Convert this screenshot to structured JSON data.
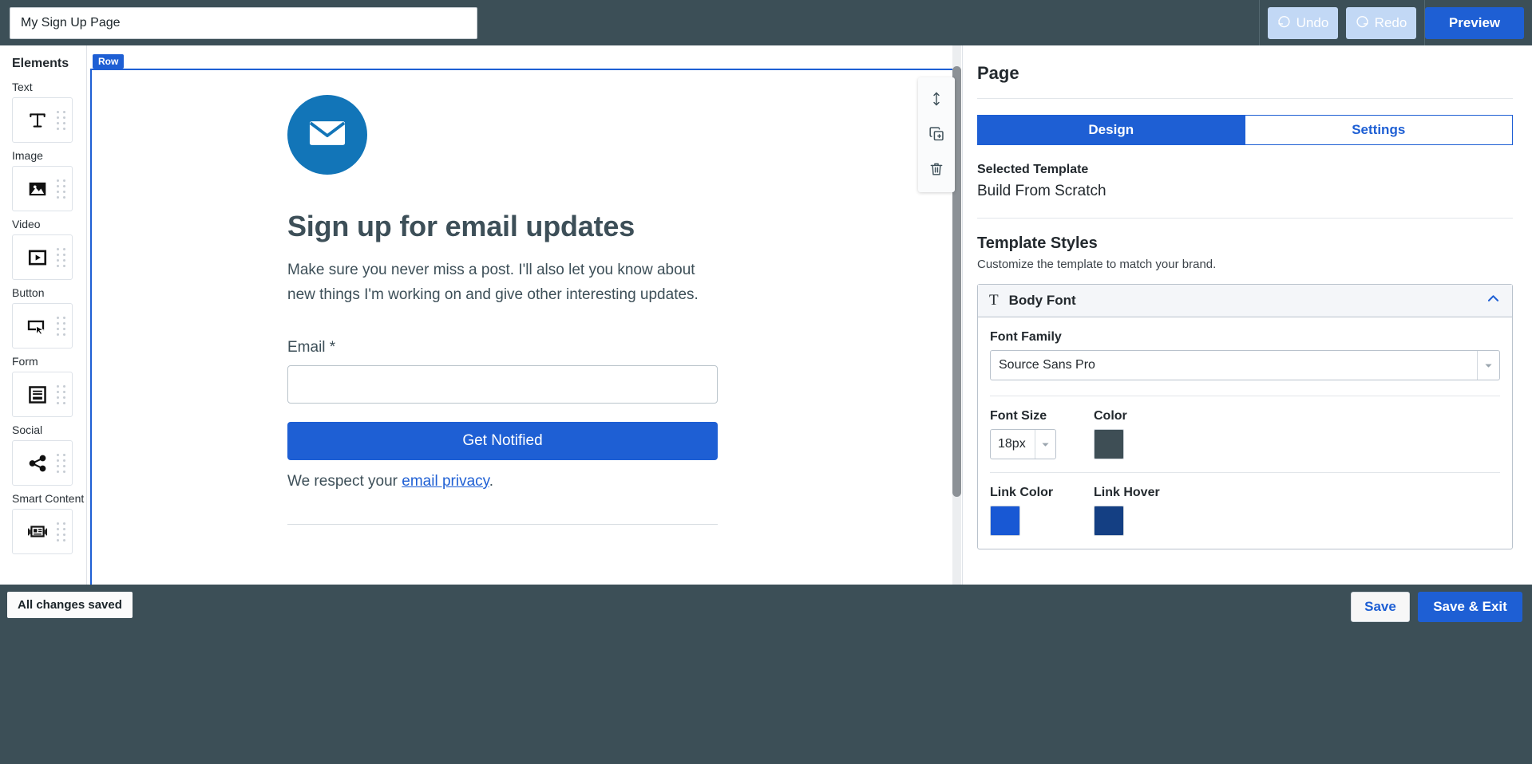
{
  "topbar": {
    "page_title_value": "My Sign Up Page",
    "page_title_placeholder": "Page name",
    "undo_label": "Undo",
    "redo_label": "Redo",
    "preview_label": "Preview",
    "undo_icon": "undo-arrow-icon",
    "redo_icon": "redo-arrow-icon",
    "bar_color": "#3c4f57",
    "primary_color": "#1e5fd4",
    "undo_redo_color": "#c2d8f5"
  },
  "sidebar": {
    "heading": "Elements",
    "items": [
      {
        "label": "Text",
        "icon": "text-t-icon"
      },
      {
        "label": "Image",
        "icon": "image-picture-icon"
      },
      {
        "label": "Video",
        "icon": "video-play-icon"
      },
      {
        "label": "Button",
        "icon": "button-cursor-icon"
      },
      {
        "label": "Form",
        "icon": "form-lines-icon"
      },
      {
        "label": "Social",
        "icon": "social-share-icon"
      },
      {
        "label": "Smart Content",
        "icon": "smart-content-icon"
      }
    ]
  },
  "canvas": {
    "row_badge": "Row",
    "tools": [
      {
        "name": "move-row",
        "icon": "move-vertical-icon"
      },
      {
        "name": "duplicate-row",
        "icon": "duplicate-icon"
      },
      {
        "name": "delete-row",
        "icon": "trash-icon"
      }
    ],
    "envelope_icon": "envelope-icon",
    "envelope_bg": "#1275b8",
    "heading": "Sign up for email updates",
    "paragraph": "Make sure you never miss a post. I'll also let you know about new things I'm working on and give other interesting updates.",
    "email_label": "Email *",
    "email_value": "",
    "email_placeholder": "",
    "submit_label": "Get Notified",
    "privacy_prefix": "We respect your ",
    "privacy_link": "email privacy",
    "privacy_suffix": ".",
    "text_color": "#3d4f58",
    "button_color": "#1e5fd4"
  },
  "right_panel": {
    "title": "Page",
    "tabs": [
      {
        "label": "Design",
        "active": true
      },
      {
        "label": "Settings",
        "active": false
      }
    ],
    "selected_template_label": "Selected Template",
    "selected_template_value": "Build From Scratch",
    "template_styles_heading": "Template Styles",
    "template_styles_desc": "Customize the template to match your brand.",
    "accordion": {
      "icon": "text-t-icon",
      "title": "Body Font",
      "chevron": "chevron-up-icon",
      "font_family_label": "Font Family",
      "font_family_value": "Source Sans Pro",
      "font_size_label": "Font Size",
      "font_size_value": "18px",
      "color_label": "Color",
      "color_value": "#3e4e55",
      "link_color_label": "Link Color",
      "link_color_value": "#1858d4",
      "link_hover_label": "Link Hover",
      "link_hover_value": "#143f83"
    }
  },
  "bottombar": {
    "status": "All changes saved",
    "save_label": "Save",
    "save_exit_label": "Save & Exit"
  }
}
